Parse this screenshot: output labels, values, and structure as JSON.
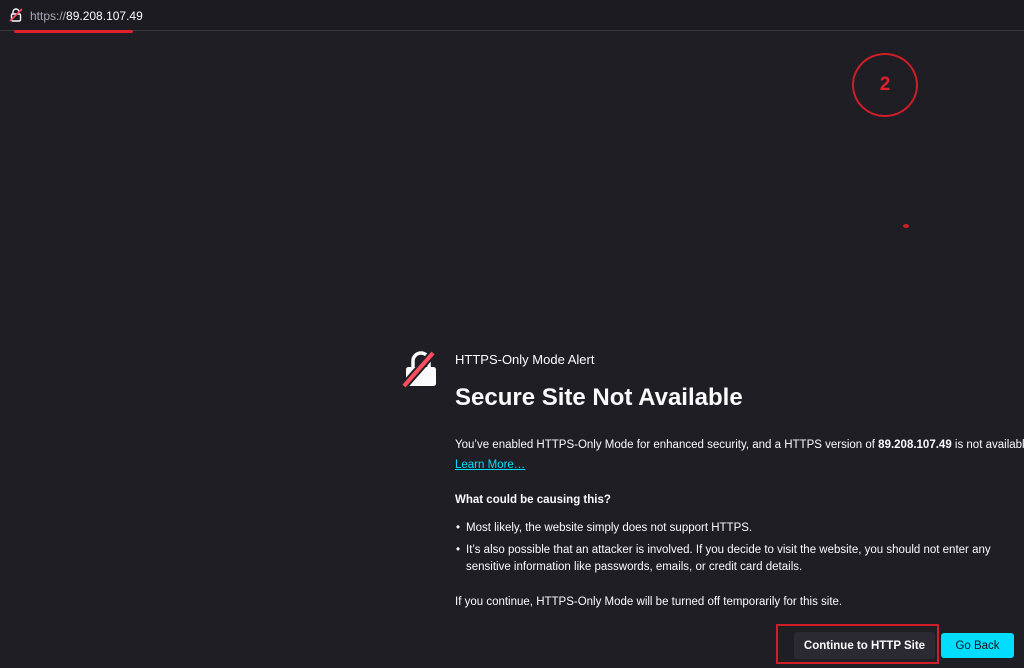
{
  "urlbar": {
    "url_scheme": "https://",
    "url_host": "89.208.107.49",
    "lock_icon": "broken-lock-icon"
  },
  "annotation": {
    "step_number": "2",
    "color": "#d01e27"
  },
  "alert": {
    "icon": "insecure-lock-icon",
    "small_heading": "HTTPS-Only Mode Alert",
    "title": "Secure Site Not Available",
    "paragraph_before": "You’ve enabled HTTPS-Only Mode for enhanced security, and a HTTPS version of ",
    "paragraph_host": "89.208.107.49",
    "paragraph_after": " is not available.",
    "learn_more": "Learn More…",
    "causes_heading": "What could be causing this?",
    "causes": [
      "Most likely, the website simply does not support HTTPS.",
      "It’s also possible that an attacker is involved. If you decide to visit the website, you should not enter any sensitive information like passwords, emails, or credit card details."
    ],
    "continue_note": "If you continue, HTTPS-Only Mode will be turned off temporarily for this site."
  },
  "buttons": {
    "continue_label": "Continue to HTTP Site",
    "back_label": "Go Back"
  },
  "colors": {
    "background": "#1f1e25",
    "accent": "#00ddff",
    "annotation_red": "#d01e27"
  }
}
